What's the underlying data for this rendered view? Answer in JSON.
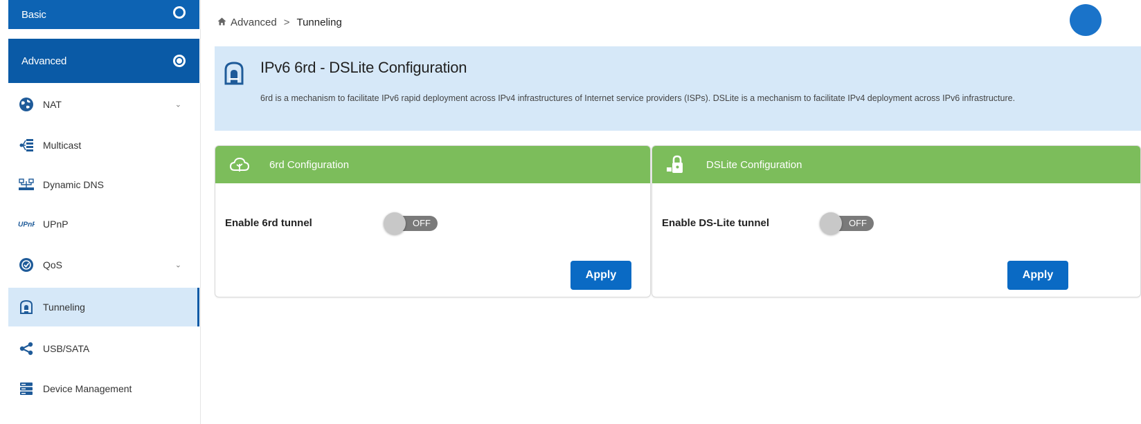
{
  "sidebar": {
    "basic_label": "Basic",
    "advanced_label": "Advanced",
    "items": [
      {
        "label": "NAT",
        "icon": "globe-icon",
        "expandable": true
      },
      {
        "label": "Multicast",
        "icon": "multicast-icon",
        "expandable": false
      },
      {
        "label": "Dynamic DNS",
        "icon": "dns-icon",
        "expandable": false
      },
      {
        "label": "UPnP",
        "icon": "upnp-icon",
        "expandable": false
      },
      {
        "label": "QoS",
        "icon": "qos-icon",
        "expandable": true
      },
      {
        "label": "Tunneling",
        "icon": "tunnel-icon",
        "expandable": false,
        "active": true
      },
      {
        "label": "USB/SATA",
        "icon": "share-icon",
        "expandable": false
      },
      {
        "label": "Device Management",
        "icon": "server-icon",
        "expandable": false
      }
    ]
  },
  "breadcrumb": {
    "root": "Advanced",
    "separator": ">",
    "current": "Tunneling"
  },
  "banner": {
    "title": "IPv6 6rd - DSLite Configuration",
    "description": "6rd is a mechanism to facilitate IPv6 rapid deployment across IPv4 infrastructures of Internet service providers (ISPs). DSLite is a mechanism to facilitate IPv4 deployment across IPv6 infrastructure."
  },
  "cards": {
    "sixrd": {
      "title": "6rd Configuration",
      "field_label": "Enable 6rd tunnel",
      "toggle_state": "OFF",
      "apply_label": "Apply"
    },
    "dslite": {
      "title": "DSLite Configuration",
      "field_label": "Enable DS-Lite tunnel",
      "toggle_state": "OFF",
      "apply_label": "Apply"
    }
  },
  "colors": {
    "primary": "#0a5aa6",
    "card_header": "#7cbd5b",
    "banner_bg": "#d6e8f8",
    "active_item_bg": "#d6e8f8"
  }
}
